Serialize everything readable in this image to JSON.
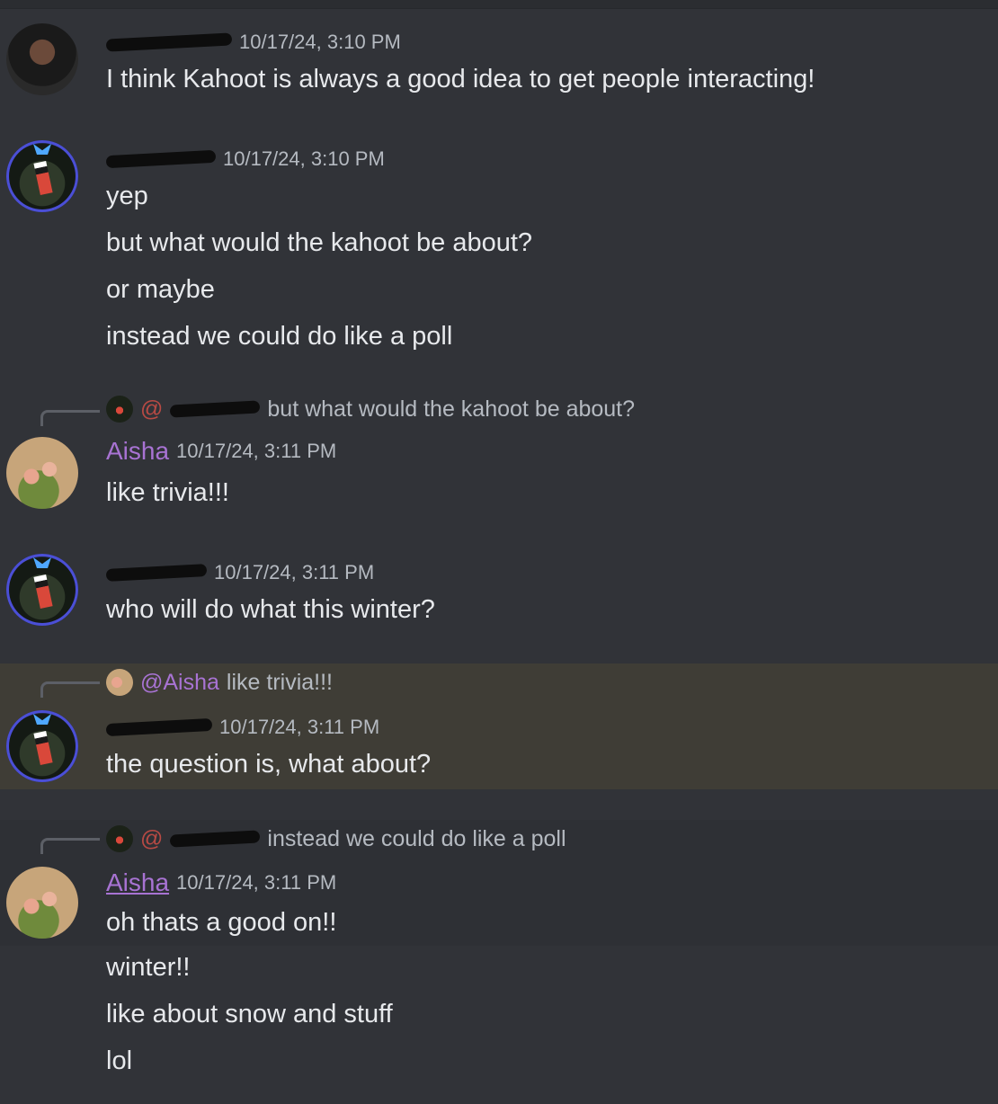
{
  "messages": [
    {
      "timestamp": "10/17/24, 3:10 PM",
      "lines": [
        "I think Kahoot is always a good idea to get people interacting!"
      ]
    },
    {
      "timestamp": "10/17/24, 3:10 PM",
      "lines": [
        "yep",
        "but what would the kahoot be about?",
        "or maybe",
        "instead we could do like a poll"
      ]
    },
    {
      "reply": {
        "text": "but what would the kahoot be about?"
      },
      "author": "Aisha",
      "timestamp": "10/17/24, 3:11 PM",
      "lines": [
        "like trivia!!!"
      ]
    },
    {
      "timestamp": "10/17/24, 3:11 PM",
      "lines": [
        "who will do what this winter?"
      ]
    },
    {
      "reply": {
        "mention": "@Aisha",
        "text": "like trivia!!!"
      },
      "timestamp": "10/17/24, 3:11 PM",
      "lines": [
        "the question is, what about?"
      ]
    },
    {
      "reply": {
        "text": "instead we could do like a poll"
      },
      "author": "Aisha",
      "timestamp": "10/17/24, 3:11 PM",
      "lines": [
        "oh thats a good on!!"
      ]
    },
    {
      "lines": [
        "winter!!",
        "like about snow and stuff",
        "lol"
      ]
    }
  ]
}
